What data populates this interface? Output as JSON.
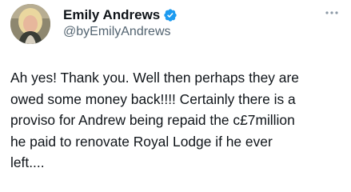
{
  "author": {
    "display_name": "Emily Andrews",
    "handle": "@byEmilyAndrews",
    "verified": true
  },
  "icons": {
    "verified": "verified-badge-icon",
    "more": "more-options-icon"
  },
  "tweet": {
    "text": "Ah yes! Thank you. Well then perhaps they are\nowed some money back!!!! Certainly there is a\nproviso for Andrew being repaid the c£7million\nhe paid to renovate Royal Lodge if he ever\nleft...."
  },
  "colors": {
    "text_primary": "#0f1419",
    "text_secondary": "#536471",
    "verified_badge": "#1d9bf0",
    "more_dots": "#8b98a5",
    "background": "#ffffff"
  }
}
